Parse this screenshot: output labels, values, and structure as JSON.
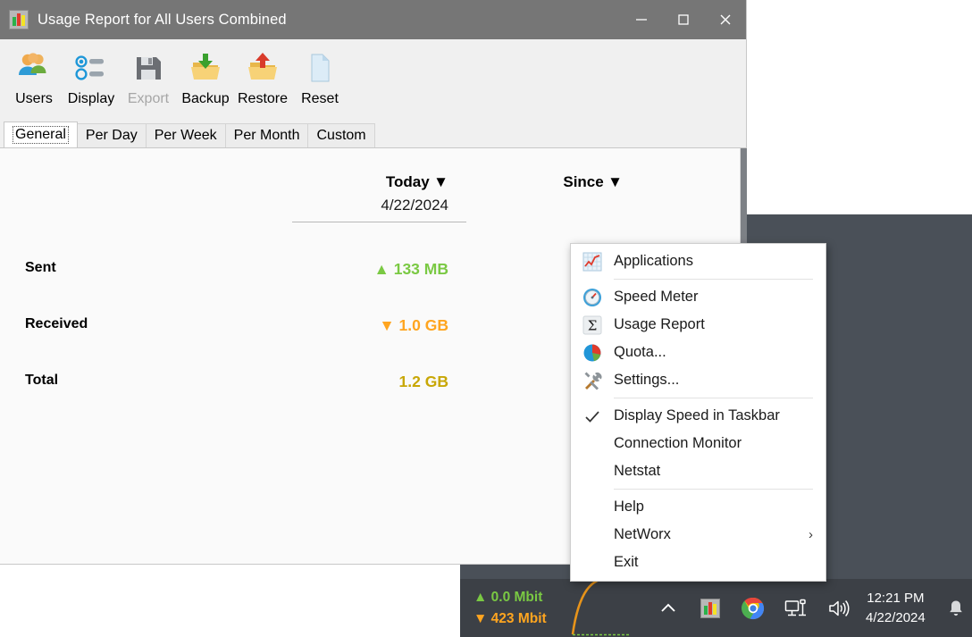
{
  "window": {
    "title": "Usage Report for All Users Combined",
    "title_icon": "networx-bars-icon",
    "controls": {
      "minimize": "minimize-icon",
      "maximize": "maximize-icon",
      "close": "close-icon"
    },
    "toolbar": [
      {
        "label": "Users",
        "icon": "users-icon",
        "disabled": false
      },
      {
        "label": "Display",
        "icon": "display-list-icon",
        "disabled": false
      },
      {
        "label": "Export",
        "icon": "floppy-save-icon",
        "disabled": true
      },
      {
        "label": "Backup",
        "icon": "folder-down-arrow-icon",
        "disabled": false
      },
      {
        "label": "Restore",
        "icon": "folder-up-arrow-icon",
        "disabled": false
      },
      {
        "label": "Reset",
        "icon": "blank-page-icon",
        "disabled": false
      }
    ],
    "tabs": [
      {
        "label": "General",
        "active": true
      },
      {
        "label": "Per Day",
        "active": false
      },
      {
        "label": "Per Week",
        "active": false
      },
      {
        "label": "Per Month",
        "active": false
      },
      {
        "label": "Custom",
        "active": false
      }
    ],
    "report": {
      "columns": [
        {
          "header": "Today",
          "sort_glyph": "▼",
          "subheader": "4/22/2024"
        },
        {
          "header": "Since",
          "sort_glyph": "▼",
          "subheader": ""
        }
      ],
      "rows": [
        {
          "label": "Sent",
          "arrow": "▲",
          "value": "133 MB",
          "color": "#7ac943"
        },
        {
          "label": "Received",
          "arrow": "▼",
          "value": "1.0 GB",
          "color": "#ffa51f"
        },
        {
          "label": "Total",
          "arrow": "",
          "value": "1.2 GB",
          "color": "#c8a706"
        }
      ]
    }
  },
  "context_menu": {
    "items": [
      {
        "label": "Applications",
        "icon": "chart-line-icon",
        "checked": false,
        "submenu": false,
        "divider_after": true
      },
      {
        "label": "Speed Meter",
        "icon": "gauge-icon",
        "checked": false,
        "submenu": false,
        "divider_after": false
      },
      {
        "label": "Usage Report",
        "icon": "sigma-icon",
        "checked": false,
        "submenu": false,
        "divider_after": false
      },
      {
        "label": "Quota...",
        "icon": "pie-chart-icon",
        "checked": false,
        "submenu": false,
        "divider_after": false
      },
      {
        "label": "Settings...",
        "icon": "tools-icon",
        "checked": false,
        "submenu": false,
        "divider_after": true
      },
      {
        "label": "Display Speed in Taskbar",
        "icon": "checkmark-icon",
        "checked": true,
        "submenu": false,
        "divider_after": false
      },
      {
        "label": "Connection Monitor",
        "icon": "",
        "checked": false,
        "submenu": false,
        "divider_after": false
      },
      {
        "label": "Netstat",
        "icon": "",
        "checked": false,
        "submenu": false,
        "divider_after": true
      },
      {
        "label": "Help",
        "icon": "",
        "checked": false,
        "submenu": false,
        "divider_after": false
      },
      {
        "label": "NetWorx",
        "icon": "",
        "checked": false,
        "submenu": true,
        "arrow": "›",
        "divider_after": false
      },
      {
        "label": "Exit",
        "icon": "",
        "checked": false,
        "submenu": false,
        "divider_after": false
      }
    ]
  },
  "taskbar": {
    "speed_up": {
      "arrow": "▲",
      "text": "0.0 Mbit",
      "color": "#7ac943"
    },
    "speed_down": {
      "arrow": "▼",
      "text": "423 Mbit",
      "color": "#ffa51f"
    },
    "graph": {
      "line_color": "#e8941a",
      "baseline_color": "#7ac943"
    },
    "tray": [
      {
        "icon": "show-hidden-icons-chevron",
        "label": ""
      },
      {
        "icon": "networx-bars-icon",
        "label": ""
      },
      {
        "icon": "chrome-icon",
        "label": ""
      },
      {
        "icon": "network-icon",
        "label": ""
      },
      {
        "icon": "volume-icon",
        "label": ""
      }
    ],
    "clock": {
      "time": "12:21 PM",
      "date": "4/22/2024"
    },
    "notification": {
      "icon": "bell-icon"
    }
  },
  "colors": {
    "titlebar": "#767676",
    "toolbar_bg": "#f0f0f0",
    "desktop": "#4a5058",
    "taskbar": "#3c4046",
    "sent_green": "#7ac943",
    "received_orange": "#ffa51f",
    "total_olive": "#c8a706"
  }
}
